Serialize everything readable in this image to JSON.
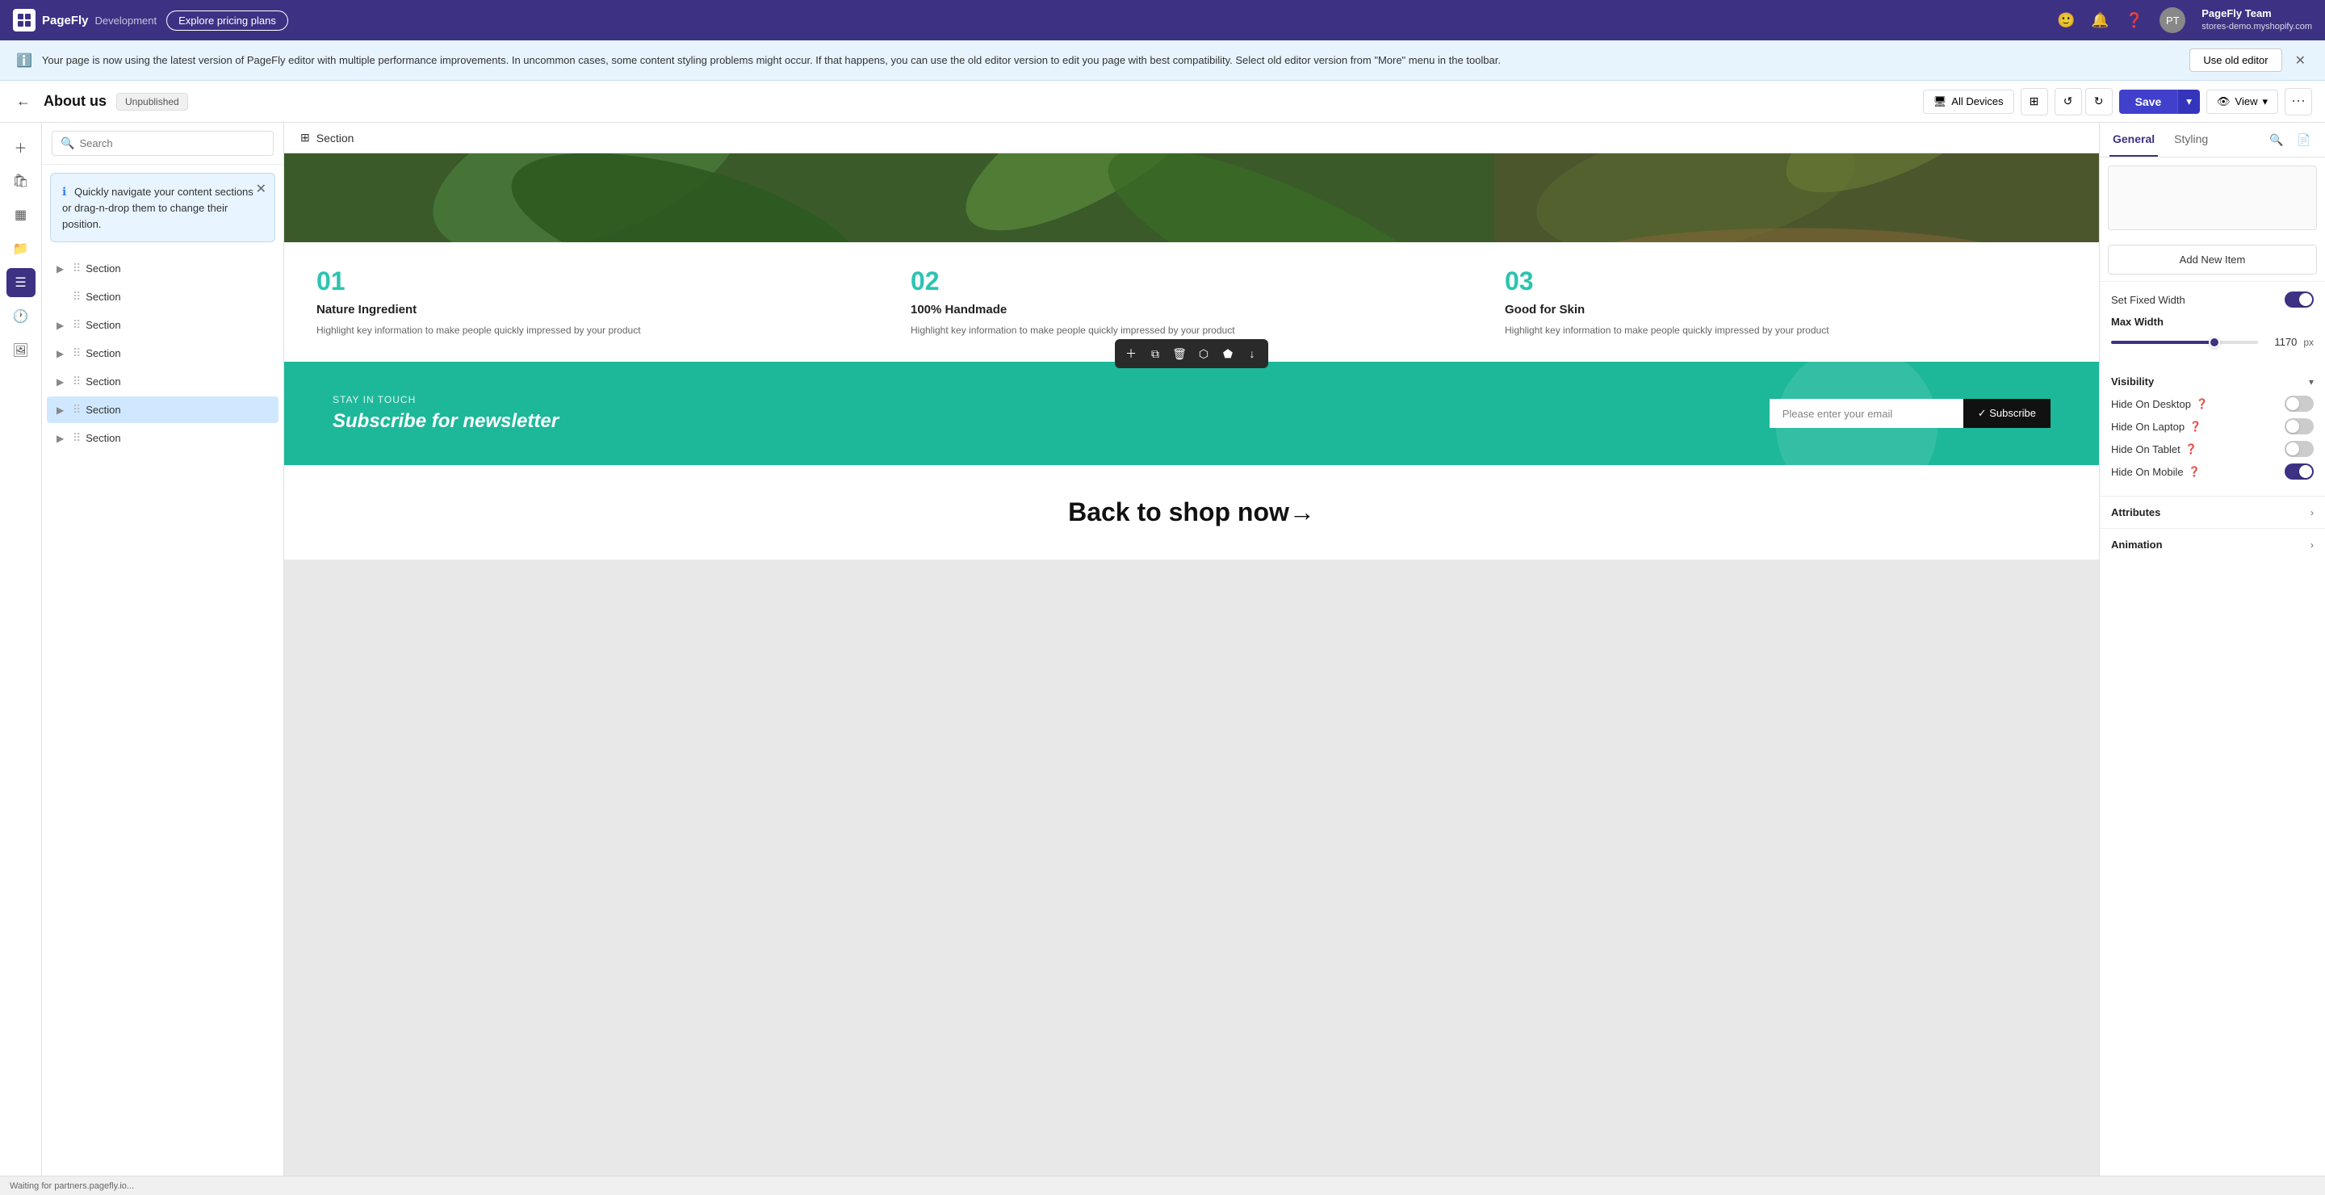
{
  "topNav": {
    "brand": "PageFly",
    "env": "Development",
    "explorePricing": "Explore pricing plans",
    "icons": [
      "emoji-icon",
      "bell-icon",
      "help-icon"
    ],
    "user": {
      "name": "PageFly Team",
      "store": "stores-demo.myshopify.com"
    }
  },
  "infoBanner": {
    "text": "Your page is now using the latest version of PageFly editor with multiple performance improvements. In uncommon cases, some content styling problems might occur. If that happens, you can use the old editor version to edit you page with best compatibility. Select old editor version from \"More\" menu in the toolbar.",
    "useOldEditor": "Use old editor"
  },
  "toolbar": {
    "pageTitle": "About us",
    "status": "Unpublished",
    "allDevices": "All Devices",
    "save": "Save",
    "view": "View"
  },
  "leftPanel": {
    "search": {
      "placeholder": "Search"
    },
    "tooltip": {
      "text": "Quickly navigate your content sections or drag-n-drop them to change their position."
    },
    "sections": [
      {
        "id": 1,
        "label": "Section",
        "hasChildren": true,
        "active": false
      },
      {
        "id": 2,
        "label": "Section",
        "hasChildren": false,
        "active": false
      },
      {
        "id": 3,
        "label": "Section",
        "hasChildren": true,
        "active": false
      },
      {
        "id": 4,
        "label": "Section",
        "hasChildren": true,
        "active": false
      },
      {
        "id": 5,
        "label": "Section",
        "hasChildren": true,
        "active": false
      },
      {
        "id": 6,
        "label": "Section",
        "hasChildren": true,
        "active": true
      },
      {
        "id": 7,
        "label": "Section",
        "hasChildren": true,
        "active": false
      }
    ]
  },
  "canvas": {
    "sectionLabel": "Section",
    "features": [
      {
        "num": "01",
        "title": "Nature Ingredient",
        "desc": "Highlight key information to make people quickly impressed by your product"
      },
      {
        "num": "02",
        "title": "100% Handmade",
        "desc": "Highlight key information to make people quickly impressed by your product"
      },
      {
        "num": "03",
        "title": "Good for Skin",
        "desc": "Highlight key information to make people quickly impressed by your product"
      }
    ],
    "newsletter": {
      "eyebrow": "STAY IN TOUCH",
      "title": "Subscribe for newsletter",
      "emailPlaceholder": "Please enter your email",
      "subscribeBtn": "✓ Subscribe"
    },
    "backToShop": "Back to shop now→"
  },
  "rightPanel": {
    "tabs": [
      "General",
      "Styling"
    ],
    "activeTab": "General",
    "addNewItem": "Add New Item",
    "setFixedWidth": "Set Fixed Width",
    "maxWidth": "Max Width",
    "maxWidthValue": "1170",
    "maxWidthUnit": "px",
    "sliderPercent": 70,
    "visibility": {
      "label": "Visibility",
      "items": [
        {
          "label": "Hide On Desktop",
          "on": false
        },
        {
          "label": "Hide On Laptop",
          "on": false
        },
        {
          "label": "Hide On Tablet",
          "on": false
        },
        {
          "label": "Hide On Mobile",
          "on": true
        }
      ]
    },
    "attributes": "Attributes",
    "animation": "Animation"
  },
  "statusBar": {
    "text": "Waiting for partners.pagefly.io..."
  }
}
